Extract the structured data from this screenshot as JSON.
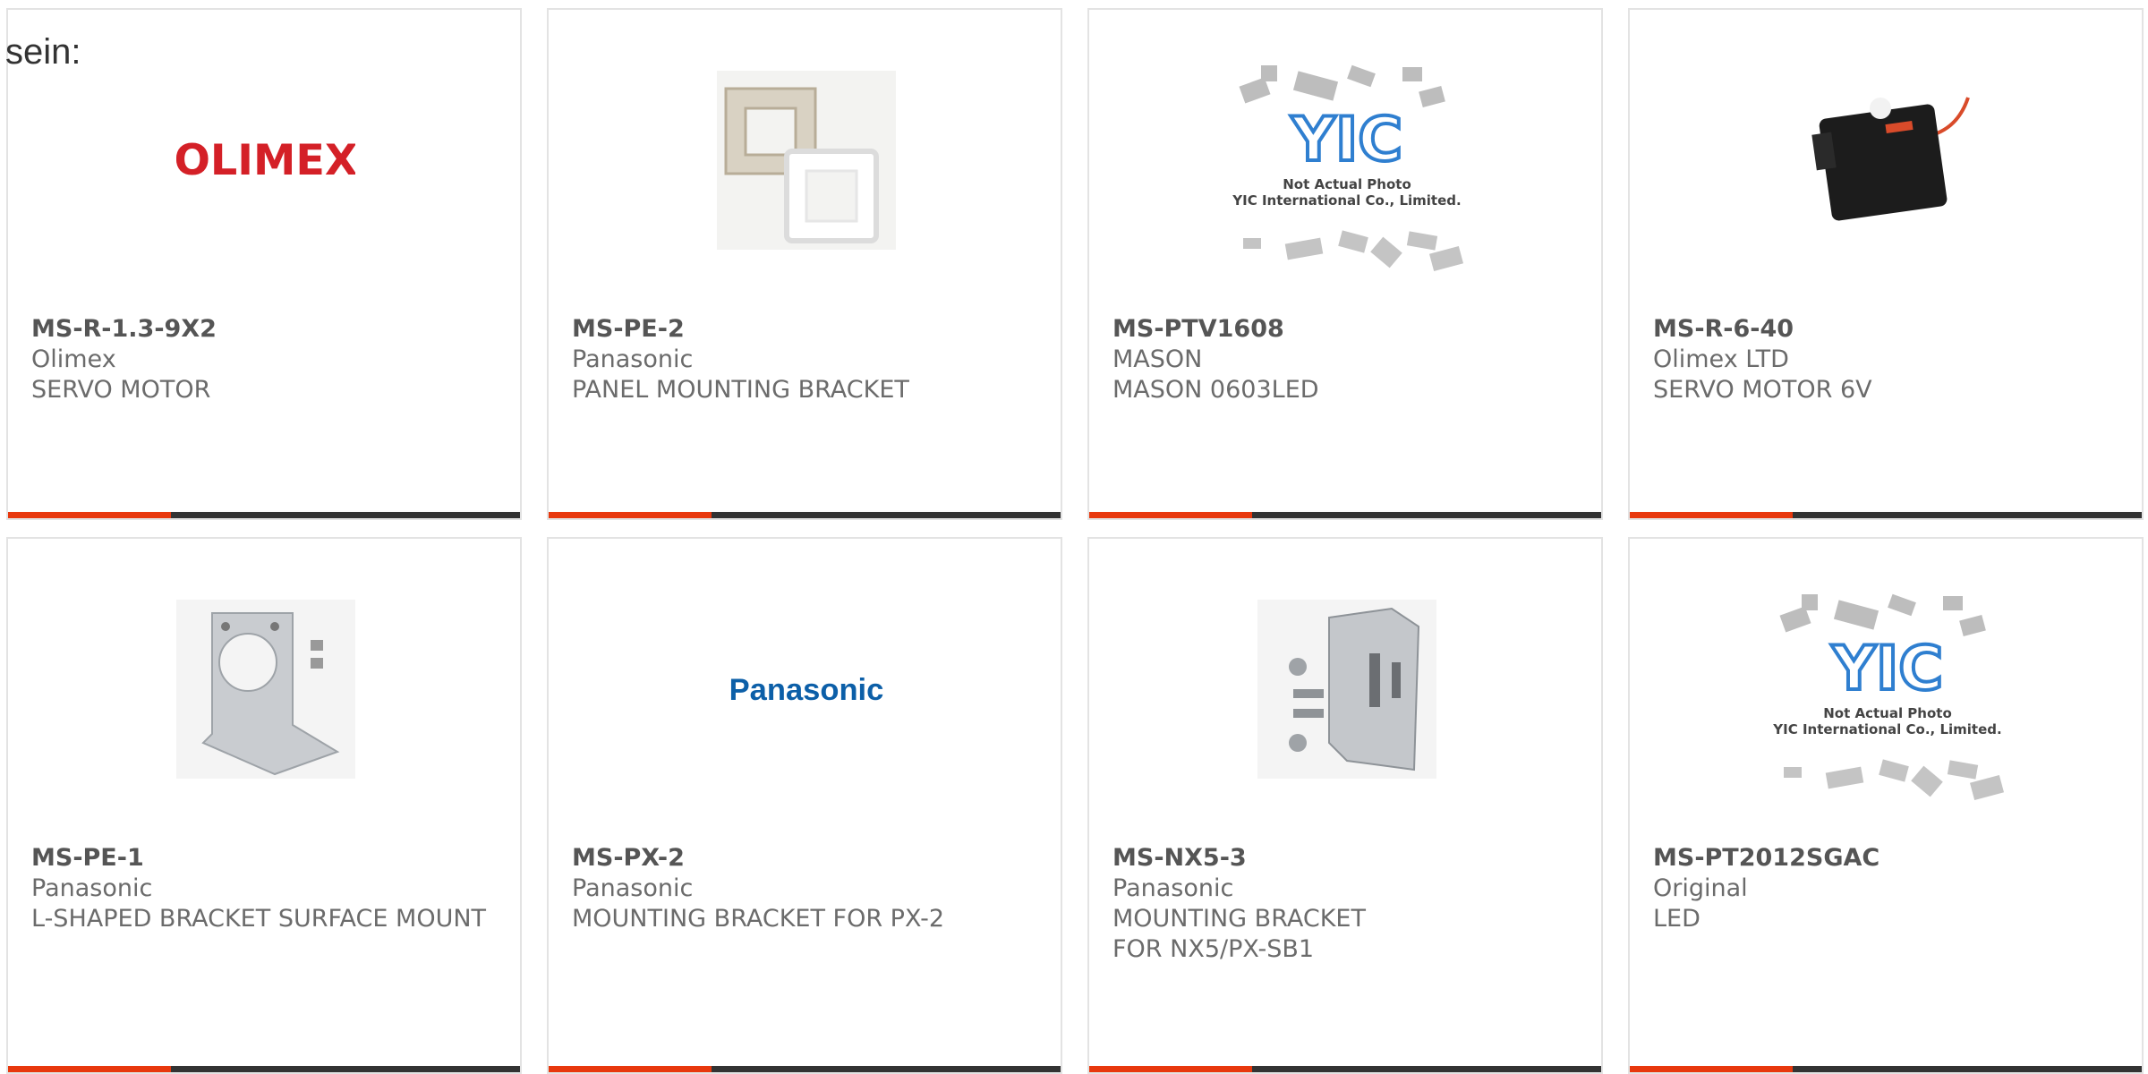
{
  "page_text": "sein:",
  "colors": {
    "accent": "#e8380d",
    "bar": "#333333",
    "border": "#e3e3e3"
  },
  "products": [
    {
      "part": "MS-R-1.3-9X2",
      "maker": "Olimex",
      "desc": "SERVO MOTOR",
      "image": "olimex-logo",
      "logo_text": "OLIMEX"
    },
    {
      "part": "MS-PE-2",
      "maker": "Panasonic",
      "desc": "PANEL MOUNTING BRACKET",
      "image": "panel-bracket-photo"
    },
    {
      "part": "MS-PTV1608",
      "maker": "MASON",
      "desc": "MASON 0603LED",
      "image": "yic-placeholder",
      "ph_line1": "Not Actual Photo",
      "ph_line2": "YIC International Co., Limited."
    },
    {
      "part": "MS-R-6-40",
      "maker": "Olimex LTD",
      "desc": "SERVO MOTOR 6V",
      "image": "servo-photo"
    },
    {
      "part": "MS-PE-1",
      "maker": "Panasonic",
      "desc": "L-SHAPED BRACKET SURFACE MOUNT",
      "image": "l-bracket-photo"
    },
    {
      "part": "MS-PX-2",
      "maker": "Panasonic",
      "desc": "MOUNTING BRACKET FOR PX-2",
      "image": "panasonic-logo",
      "logo_text": "Panasonic"
    },
    {
      "part": "MS-NX5-3",
      "maker": "Panasonic",
      "desc": "MOUNTING BRACKET FOR NX5/PX-SB1",
      "image": "nx5-bracket-photo"
    },
    {
      "part": "MS-PT2012SGAC",
      "maker": "Original",
      "desc": "LED",
      "image": "yic-placeholder",
      "ph_line1": "Not Actual Photo",
      "ph_line2": "YIC International Co., Limited."
    }
  ]
}
